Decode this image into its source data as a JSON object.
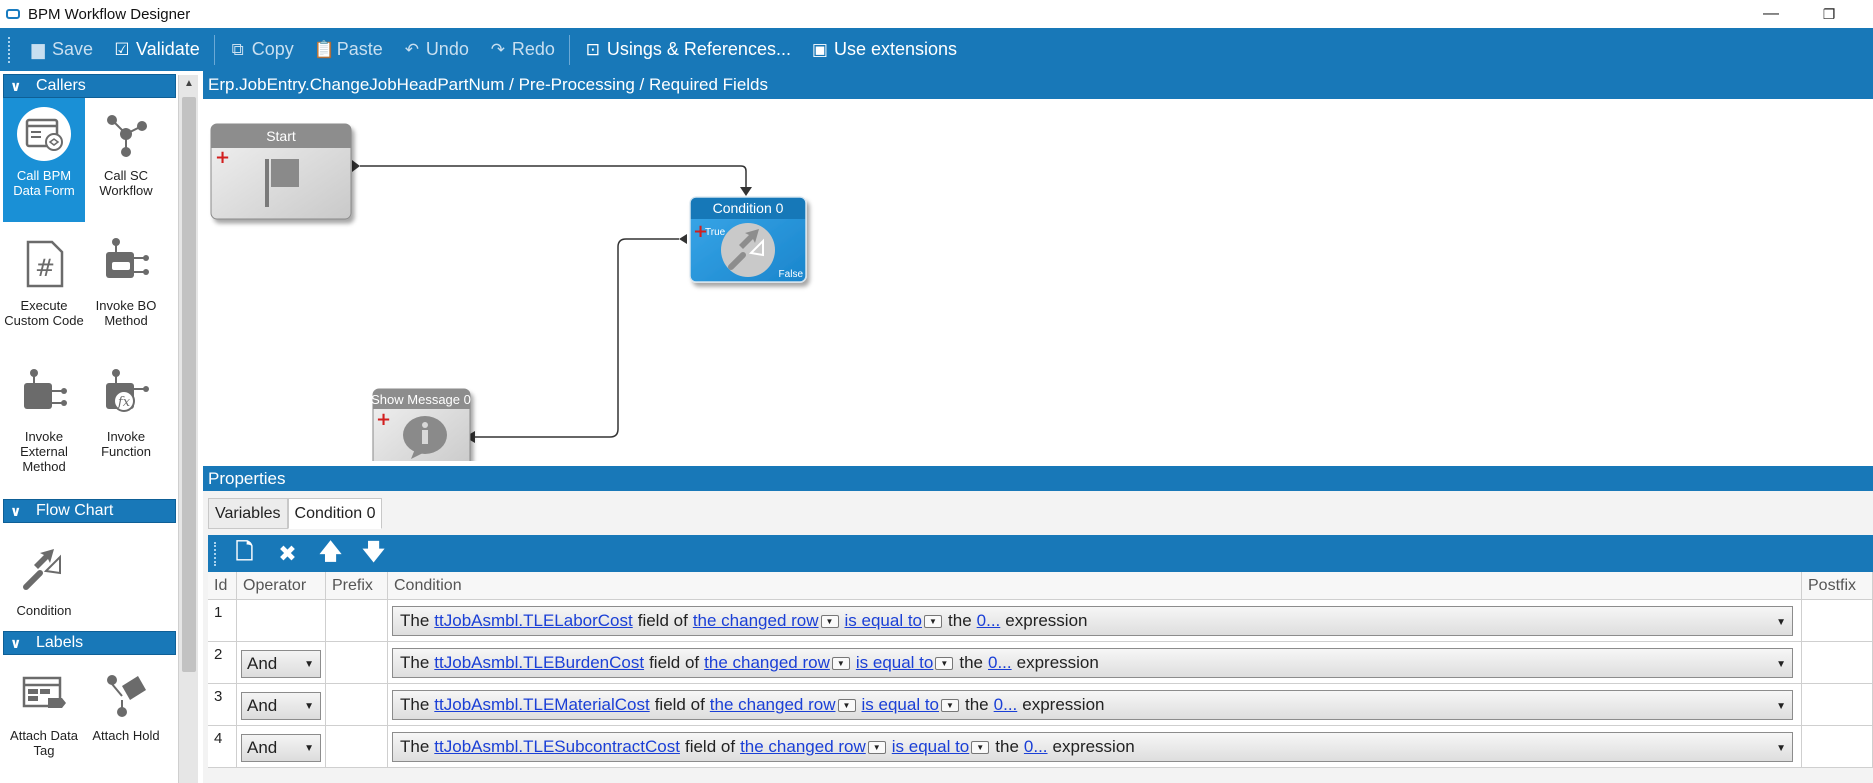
{
  "window": {
    "title": "BPM Workflow Designer",
    "min_glyph": "—",
    "restore_glyph": "❐"
  },
  "toolbar": {
    "save": "Save",
    "validate": "Validate",
    "copy": "Copy",
    "paste": "Paste",
    "undo": "Undo",
    "redo": "Redo",
    "usings": "Usings & References...",
    "extensions": "Use extensions"
  },
  "sidebar": {
    "callers": {
      "title": "Callers",
      "items": [
        {
          "label": "Call BPM Data Form",
          "icon": "data-form-icon"
        },
        {
          "label": "Call SC Workflow",
          "icon": "workflow-icon"
        },
        {
          "label": "Execute Custom Code",
          "icon": "custom-code-icon"
        },
        {
          "label": "Invoke BO Method",
          "icon": "bo-method-icon"
        },
        {
          "label": "Invoke External Method",
          "icon": "external-method-icon"
        },
        {
          "label": "Invoke Function",
          "icon": "function-icon"
        }
      ]
    },
    "flowchart": {
      "title": "Flow Chart",
      "items": [
        {
          "label": "Condition",
          "icon": "condition-icon"
        }
      ]
    },
    "labels": {
      "title": "Labels",
      "items": [
        {
          "label": "Attach Data Tag",
          "icon": "data-tag-icon"
        },
        {
          "label": "Attach Hold",
          "icon": "hold-icon"
        }
      ]
    }
  },
  "canvas": {
    "breadcrumb": "Erp.JobEntry.ChangeJobHeadPartNum / Pre-Processing / Required Fields",
    "nodes": {
      "start": {
        "title": "Start"
      },
      "condition": {
        "title": "Condition 0",
        "true_label": "True",
        "false_label": "False"
      },
      "message": {
        "title": "Show Message 0"
      }
    }
  },
  "properties": {
    "title": "Properties",
    "tabs": [
      "Variables",
      "Condition 0"
    ],
    "columns": {
      "id": "Id",
      "operator": "Operator",
      "prefix": "Prefix",
      "condition": "Condition",
      "postfix": "Postfix"
    },
    "rows": [
      {
        "id": "1",
        "operator": "",
        "field": "ttJobAsmbl.TLELaborCost",
        "row": "the changed row",
        "cmp": "is equal to",
        "val": "0..."
      },
      {
        "id": "2",
        "operator": "And",
        "field": "ttJobAsmbl.TLEBurdenCost",
        "row": "the changed row",
        "cmp": "is equal to",
        "val": "0..."
      },
      {
        "id": "3",
        "operator": "And",
        "field": "ttJobAsmbl.TLEMaterialCost",
        "row": "the changed row",
        "cmp": "is equal to",
        "val": "0..."
      },
      {
        "id": "4",
        "operator": "And",
        "field": "ttJobAsmbl.TLESubcontractCost",
        "row": "the changed row",
        "cmp": "is equal to",
        "val": "0..."
      }
    ],
    "text": {
      "the": "The",
      "field_of": "field of",
      "the2": "the",
      "expression": "expression"
    }
  },
  "colors": {
    "accent": "#1878b8",
    "selected": "#1a90d6",
    "link": "#1a3fd6"
  }
}
